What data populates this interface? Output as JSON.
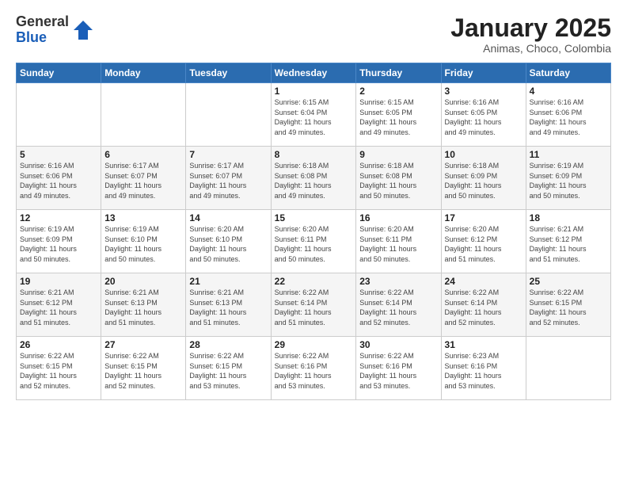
{
  "logo": {
    "general": "General",
    "blue": "Blue"
  },
  "header": {
    "month": "January 2025",
    "location": "Animas, Choco, Colombia"
  },
  "weekdays": [
    "Sunday",
    "Monday",
    "Tuesday",
    "Wednesday",
    "Thursday",
    "Friday",
    "Saturday"
  ],
  "weeks": [
    [
      {
        "day": "",
        "info": ""
      },
      {
        "day": "",
        "info": ""
      },
      {
        "day": "",
        "info": ""
      },
      {
        "day": "1",
        "info": "Sunrise: 6:15 AM\nSunset: 6:04 PM\nDaylight: 11 hours\nand 49 minutes."
      },
      {
        "day": "2",
        "info": "Sunrise: 6:15 AM\nSunset: 6:05 PM\nDaylight: 11 hours\nand 49 minutes."
      },
      {
        "day": "3",
        "info": "Sunrise: 6:16 AM\nSunset: 6:05 PM\nDaylight: 11 hours\nand 49 minutes."
      },
      {
        "day": "4",
        "info": "Sunrise: 6:16 AM\nSunset: 6:06 PM\nDaylight: 11 hours\nand 49 minutes."
      }
    ],
    [
      {
        "day": "5",
        "info": "Sunrise: 6:16 AM\nSunset: 6:06 PM\nDaylight: 11 hours\nand 49 minutes."
      },
      {
        "day": "6",
        "info": "Sunrise: 6:17 AM\nSunset: 6:07 PM\nDaylight: 11 hours\nand 49 minutes."
      },
      {
        "day": "7",
        "info": "Sunrise: 6:17 AM\nSunset: 6:07 PM\nDaylight: 11 hours\nand 49 minutes."
      },
      {
        "day": "8",
        "info": "Sunrise: 6:18 AM\nSunset: 6:08 PM\nDaylight: 11 hours\nand 49 minutes."
      },
      {
        "day": "9",
        "info": "Sunrise: 6:18 AM\nSunset: 6:08 PM\nDaylight: 11 hours\nand 50 minutes."
      },
      {
        "day": "10",
        "info": "Sunrise: 6:18 AM\nSunset: 6:09 PM\nDaylight: 11 hours\nand 50 minutes."
      },
      {
        "day": "11",
        "info": "Sunrise: 6:19 AM\nSunset: 6:09 PM\nDaylight: 11 hours\nand 50 minutes."
      }
    ],
    [
      {
        "day": "12",
        "info": "Sunrise: 6:19 AM\nSunset: 6:09 PM\nDaylight: 11 hours\nand 50 minutes."
      },
      {
        "day": "13",
        "info": "Sunrise: 6:19 AM\nSunset: 6:10 PM\nDaylight: 11 hours\nand 50 minutes."
      },
      {
        "day": "14",
        "info": "Sunrise: 6:20 AM\nSunset: 6:10 PM\nDaylight: 11 hours\nand 50 minutes."
      },
      {
        "day": "15",
        "info": "Sunrise: 6:20 AM\nSunset: 6:11 PM\nDaylight: 11 hours\nand 50 minutes."
      },
      {
        "day": "16",
        "info": "Sunrise: 6:20 AM\nSunset: 6:11 PM\nDaylight: 11 hours\nand 50 minutes."
      },
      {
        "day": "17",
        "info": "Sunrise: 6:20 AM\nSunset: 6:12 PM\nDaylight: 11 hours\nand 51 minutes."
      },
      {
        "day": "18",
        "info": "Sunrise: 6:21 AM\nSunset: 6:12 PM\nDaylight: 11 hours\nand 51 minutes."
      }
    ],
    [
      {
        "day": "19",
        "info": "Sunrise: 6:21 AM\nSunset: 6:12 PM\nDaylight: 11 hours\nand 51 minutes."
      },
      {
        "day": "20",
        "info": "Sunrise: 6:21 AM\nSunset: 6:13 PM\nDaylight: 11 hours\nand 51 minutes."
      },
      {
        "day": "21",
        "info": "Sunrise: 6:21 AM\nSunset: 6:13 PM\nDaylight: 11 hours\nand 51 minutes."
      },
      {
        "day": "22",
        "info": "Sunrise: 6:22 AM\nSunset: 6:14 PM\nDaylight: 11 hours\nand 51 minutes."
      },
      {
        "day": "23",
        "info": "Sunrise: 6:22 AM\nSunset: 6:14 PM\nDaylight: 11 hours\nand 52 minutes."
      },
      {
        "day": "24",
        "info": "Sunrise: 6:22 AM\nSunset: 6:14 PM\nDaylight: 11 hours\nand 52 minutes."
      },
      {
        "day": "25",
        "info": "Sunrise: 6:22 AM\nSunset: 6:15 PM\nDaylight: 11 hours\nand 52 minutes."
      }
    ],
    [
      {
        "day": "26",
        "info": "Sunrise: 6:22 AM\nSunset: 6:15 PM\nDaylight: 11 hours\nand 52 minutes."
      },
      {
        "day": "27",
        "info": "Sunrise: 6:22 AM\nSunset: 6:15 PM\nDaylight: 11 hours\nand 52 minutes."
      },
      {
        "day": "28",
        "info": "Sunrise: 6:22 AM\nSunset: 6:15 PM\nDaylight: 11 hours\nand 53 minutes."
      },
      {
        "day": "29",
        "info": "Sunrise: 6:22 AM\nSunset: 6:16 PM\nDaylight: 11 hours\nand 53 minutes."
      },
      {
        "day": "30",
        "info": "Sunrise: 6:22 AM\nSunset: 6:16 PM\nDaylight: 11 hours\nand 53 minutes."
      },
      {
        "day": "31",
        "info": "Sunrise: 6:23 AM\nSunset: 6:16 PM\nDaylight: 11 hours\nand 53 minutes."
      },
      {
        "day": "",
        "info": ""
      }
    ]
  ]
}
